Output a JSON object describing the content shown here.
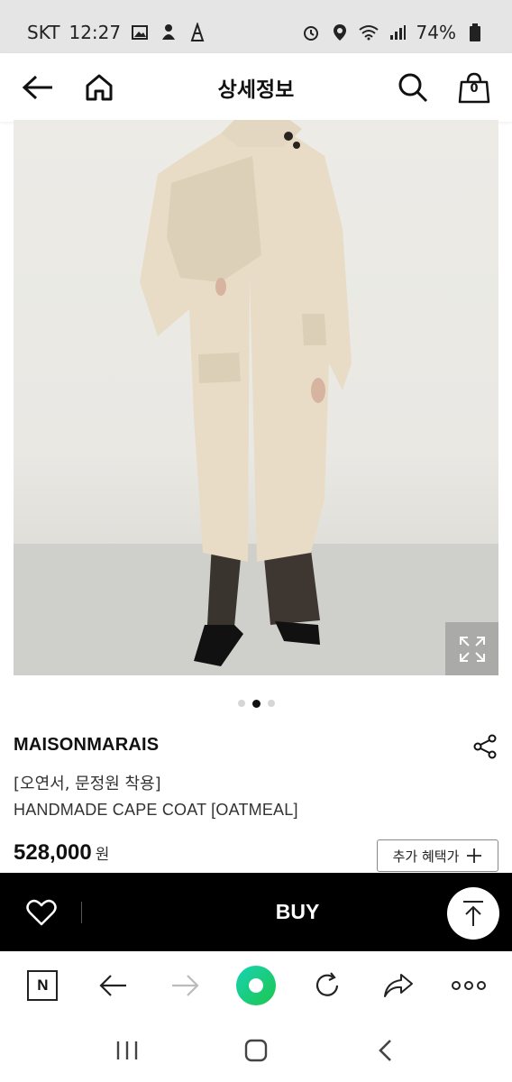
{
  "status_bar": {
    "carrier": "SKT",
    "time": "12:27",
    "battery": "74%",
    "icons_left": [
      "gallery-icon",
      "notification-icon",
      "notification-icon"
    ],
    "icons_right": [
      "alarm-icon",
      "location-icon",
      "wifi-icon",
      "signal-icon",
      "battery-icon"
    ]
  },
  "header": {
    "title": "상세정보",
    "cart_count": "0"
  },
  "carousel": {
    "total": 3,
    "active_index": 1
  },
  "product": {
    "brand": "MAISONMARAIS",
    "subtitle": "[오연서, 문정원 착용]",
    "name": "HANDMADE CAPE COAT [OATMEAL]",
    "price": "528,000",
    "currency": "원",
    "benefit_label": "추가 혜택가"
  },
  "buy_bar": {
    "buy_label": "BUY"
  },
  "browser_toolbar": {
    "naver_label": "N"
  }
}
